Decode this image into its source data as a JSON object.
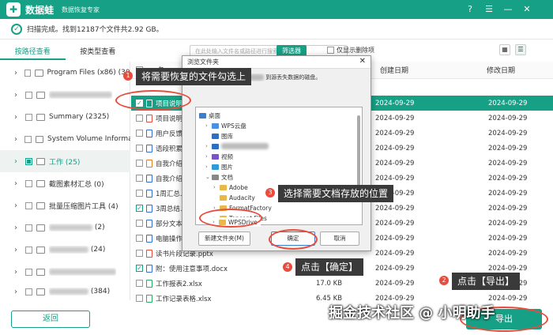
{
  "app": {
    "name": "数据蛙",
    "subtitle": "数据恢复专家"
  },
  "status": {
    "text": "扫描完成。找到12187个文件共2.92 GB。"
  },
  "tabs": [
    {
      "label": "按路径查看"
    },
    {
      "label": "按类型查看"
    }
  ],
  "toolbar": {
    "search_placeholder": "在此处输入文件名或路径进行搜索",
    "filter_label": "筛选器",
    "only_deleted": "仅显示删除项"
  },
  "sidebar": {
    "items": [
      {
        "label": "Program Files (x86) (3010"
      },
      {
        "label": ""
      },
      {
        "label": "Summary (2325)"
      },
      {
        "label": "System Volume Informati"
      },
      {
        "label": "工作 (25)"
      },
      {
        "label": "截图素材汇总 (0)"
      },
      {
        "label": "批量压缩图片工具 (4)"
      },
      {
        "label": "(2)"
      },
      {
        "label": "(24)"
      },
      {
        "label": ""
      },
      {
        "label": "(384)"
      }
    ]
  },
  "table": {
    "headers": {
      "name": "名",
      "cdate": "创建日期",
      "mdate": "修改日期"
    },
    "rows": [
      {
        "name": "项目说明书",
        "size": "",
        "cdate": "2024-09-29",
        "mdate": "2024-09-29"
      },
      {
        "name": "项目说明书",
        "size": "",
        "cdate": "2024-09-29",
        "mdate": "2024-09-29"
      },
      {
        "name": "用户反馈",
        "size": "",
        "cdate": "2024-09-29",
        "mdate": "2024-09-29"
      },
      {
        "name": "语段积累.d",
        "size": "",
        "cdate": "2024-09-29",
        "mdate": "2024-09-29"
      },
      {
        "name": "自我介绍.p",
        "size": "",
        "cdate": "2024-09-29",
        "mdate": "2024-09-29"
      },
      {
        "name": "自我介绍.t",
        "size": "",
        "cdate": "2024-09-29",
        "mdate": "2024-09-29"
      },
      {
        "name": "1周汇总.do",
        "size": "",
        "cdate": "2024-09-29",
        "mdate": "2024-09-29"
      },
      {
        "name": "3周总结.do",
        "size": "",
        "cdate": "2024-09-29",
        "mdate": "2024-09-29"
      },
      {
        "name": "部分文本格",
        "size": "",
        "cdate": "2024-09-29",
        "mdate": "2024-09-29"
      },
      {
        "name": "电脑操作说",
        "size": "",
        "cdate": "2024-09-29",
        "mdate": "2024-09-29"
      },
      {
        "name": "读书片段记录.pptx",
        "size": "",
        "cdate": "2024-09-29",
        "mdate": "2024-09-29"
      },
      {
        "name": "附：使用注意事项.docx",
        "size": "",
        "cdate": "2024-09-29",
        "mdate": "2024-09-29"
      },
      {
        "name": "工作报表2.xlsx",
        "size": "17.0 KB",
        "cdate": "2024-09-29",
        "mdate": "2024-09-29"
      },
      {
        "name": "工作记录表格.xlsx",
        "size": "6.45 KB",
        "cdate": "2024-09-29",
        "mdate": "2024-09-29"
      }
    ]
  },
  "dialog": {
    "title": "浏览文件夹",
    "desc": "到源丢失数据的磁盘。",
    "tree": [
      "桌面",
      "WPS云盘",
      "图库",
      "",
      "视频",
      "图片",
      "文档",
      "Adobe",
      "Audacity",
      "FormatFactory",
      "Tencent Files",
      "WPSDrive"
    ],
    "new_folder": "新建文件夹(M)",
    "ok": "确定",
    "cancel": "取消"
  },
  "buttons": {
    "back": "返回",
    "export": "导出"
  },
  "annotations": {
    "a1": "将需要恢复的文件勾选上",
    "a2": "点击【导出】",
    "a3": "选择需要文档存放的位置",
    "a4": "点击【确定】",
    "n1": "1",
    "n2": "2",
    "n3": "3",
    "n4": "4"
  },
  "watermark": "掘金技术社区 @ 小明助手",
  "colors": {
    "accent": "#16a085",
    "annotation": "#e74c3c"
  }
}
